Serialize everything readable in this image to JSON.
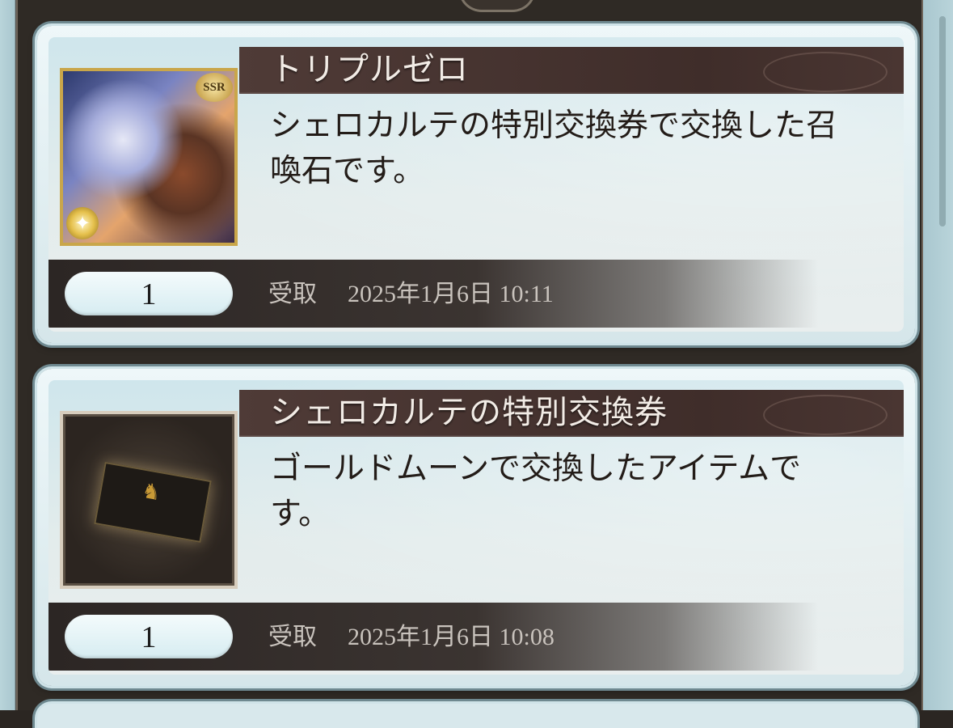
{
  "items": [
    {
      "name": "トリプルゼロ",
      "description": "シェロカルテの特別交換券で交換した召喚石です。",
      "thumbnail_icon": "summon-stone-icon",
      "rarity": "SSR",
      "count": "1",
      "received_label": "受取",
      "received_at": "2025年1月6日 10:11"
    },
    {
      "name": "シェロカルテの特別交換券",
      "description": "ゴールドムーンで交換したアイテムです。",
      "thumbnail_icon": "ticket-icon",
      "count": "1",
      "received_label": "受取",
      "received_at": "2025年1月6日 10:08"
    }
  ]
}
